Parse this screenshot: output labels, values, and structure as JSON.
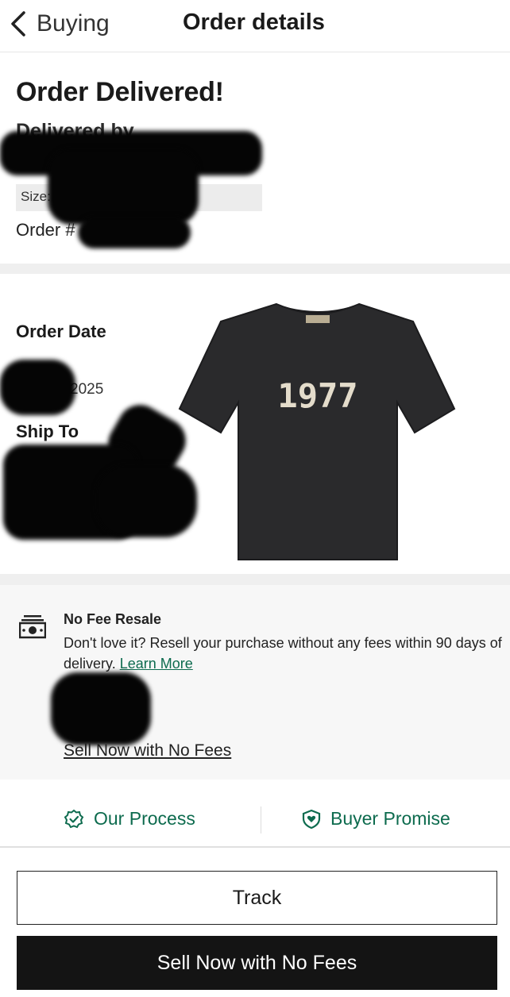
{
  "nav": {
    "back_label": "Buying",
    "title": "Order details"
  },
  "status": {
    "heading": "Order Delivered!",
    "delivered_by": "Delivered by",
    "tracking_link": "",
    "size": "Size: U",
    "order_number": "Order #"
  },
  "details": {
    "order_date_label": "Order Date",
    "order_date_value": "2025",
    "ship_to_label": "Ship To",
    "product_print": "1977"
  },
  "resale": {
    "title": "No Fee Resale",
    "text": "Don't love it? Resell your purchase without any fees within 90 days of delivery.",
    "learn_more": "Learn More",
    "sell_link": "Sell Now with No Fees"
  },
  "footer_links": {
    "process": "Our Process",
    "promise": "Buyer Promise"
  },
  "actions": {
    "track": "Track",
    "sell": "Sell Now with No Fees"
  },
  "colors": {
    "accent_green": "#0d6b4e",
    "primary_black": "#141414"
  },
  "icons": [
    "chevron-left-icon",
    "cash-icon",
    "verified-badge-icon",
    "shield-heart-icon"
  ]
}
